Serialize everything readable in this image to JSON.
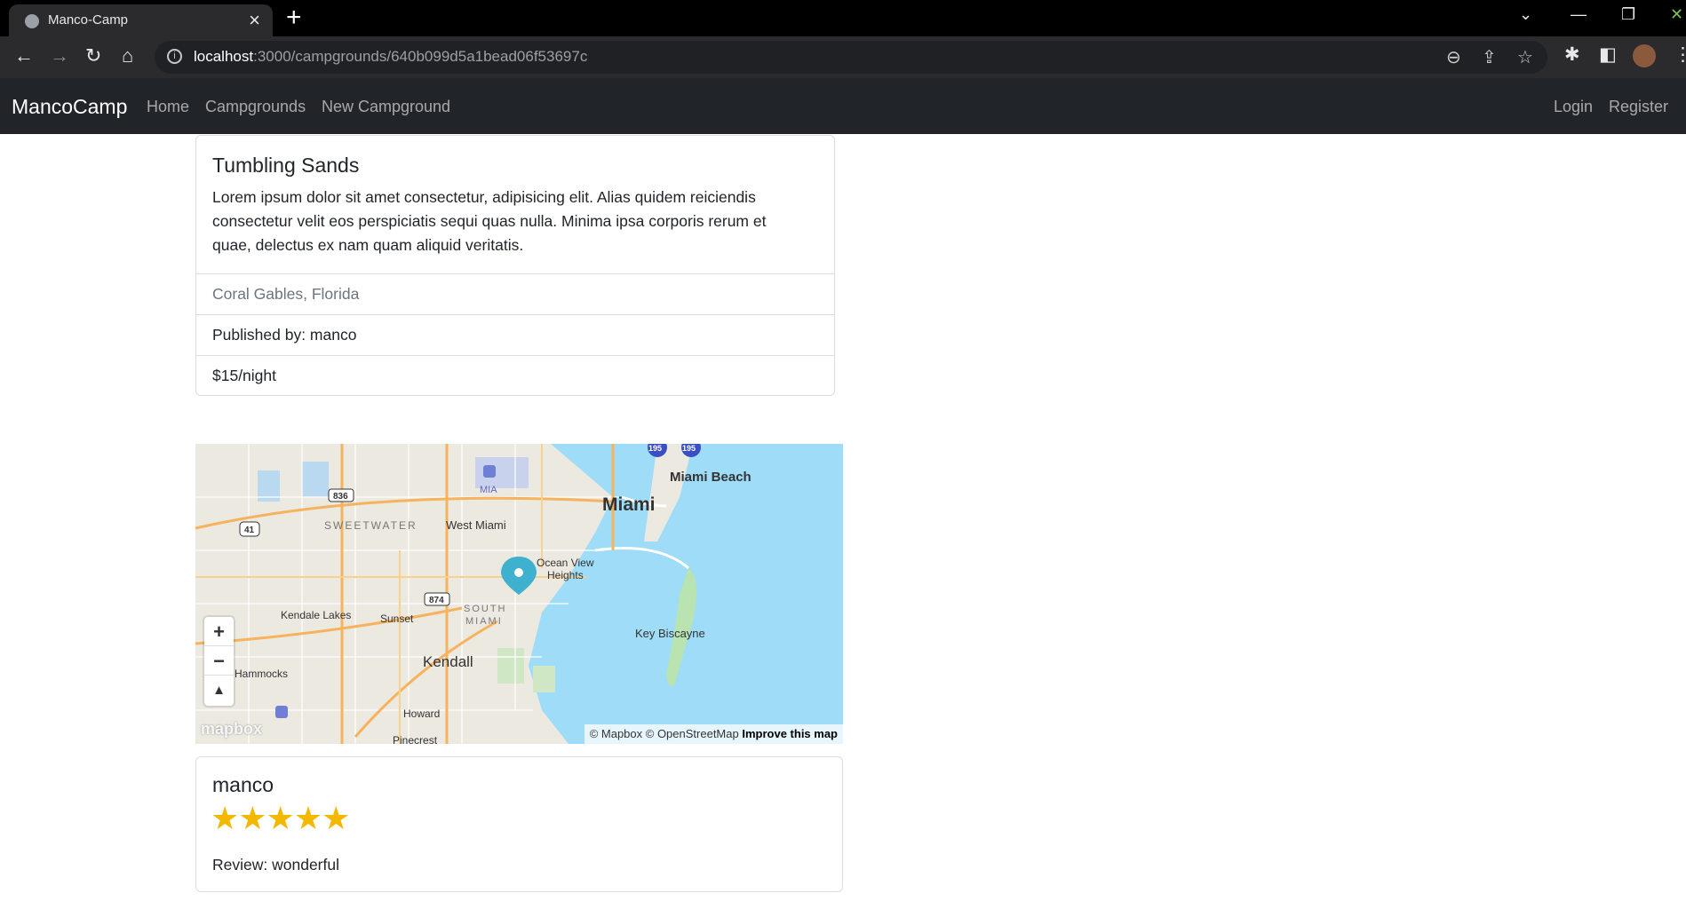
{
  "browser": {
    "tab_title": "Manco-Camp",
    "url_host": "localhost",
    "url_path": ":3000/campgrounds/640b099d5a1bead06f53697c"
  },
  "nav": {
    "brand": "MancoCamp",
    "links": [
      "Home",
      "Campgrounds",
      "New Campground"
    ],
    "login": "Login",
    "register": "Register"
  },
  "campground": {
    "title": "Tumbling Sands",
    "description": "Lorem ipsum dolor sit amet consectetur, adipisicing elit. Alias quidem reiciendis consectetur velit eos perspiciatis sequi quas nulla. Minima ipsa corporis rerum et quae, delectus ex nam quam aliquid veritatis.",
    "location": "Coral Gables, Florida",
    "author": "Published by: manco",
    "price": "$15/night"
  },
  "map": {
    "labels": {
      "miami": "Miami",
      "miami_beach": "Miami Beach",
      "mia": "MIA",
      "sweetwater": "SWEETWATER",
      "west_miami": "West Miami",
      "ocean_view_1": "Ocean View",
      "ocean_view_2": "Heights",
      "south_miami_1": "SOUTH",
      "south_miami_2": "MIAMI",
      "kendale_lakes": "Kendale Lakes",
      "sunset": "Sunset",
      "key_biscayne": "Key Biscayne",
      "kendall": "Kendall",
      "hammocks": "Hammocks",
      "howard": "Howard",
      "pinecrest": "Pinecrest",
      "shield_836": "836",
      "shield_41": "41",
      "shield_874": "874",
      "shield_195a": "195",
      "shield_195b": "195"
    },
    "zoom_in": "+",
    "zoom_out": "−",
    "compass": "▲",
    "logo": "mapbox",
    "attribution": "© Mapbox © OpenStreetMap",
    "improve": "Improve this map",
    "water_color": "#9fdcf7",
    "land_color": "#ece9e1",
    "pin_color": "#3fb1ce"
  },
  "review": {
    "author": "manco",
    "rating": 5,
    "max_rating": 5,
    "stars": "★★★★★",
    "text": "Review: wonderful",
    "star_color": "#f5b800"
  }
}
